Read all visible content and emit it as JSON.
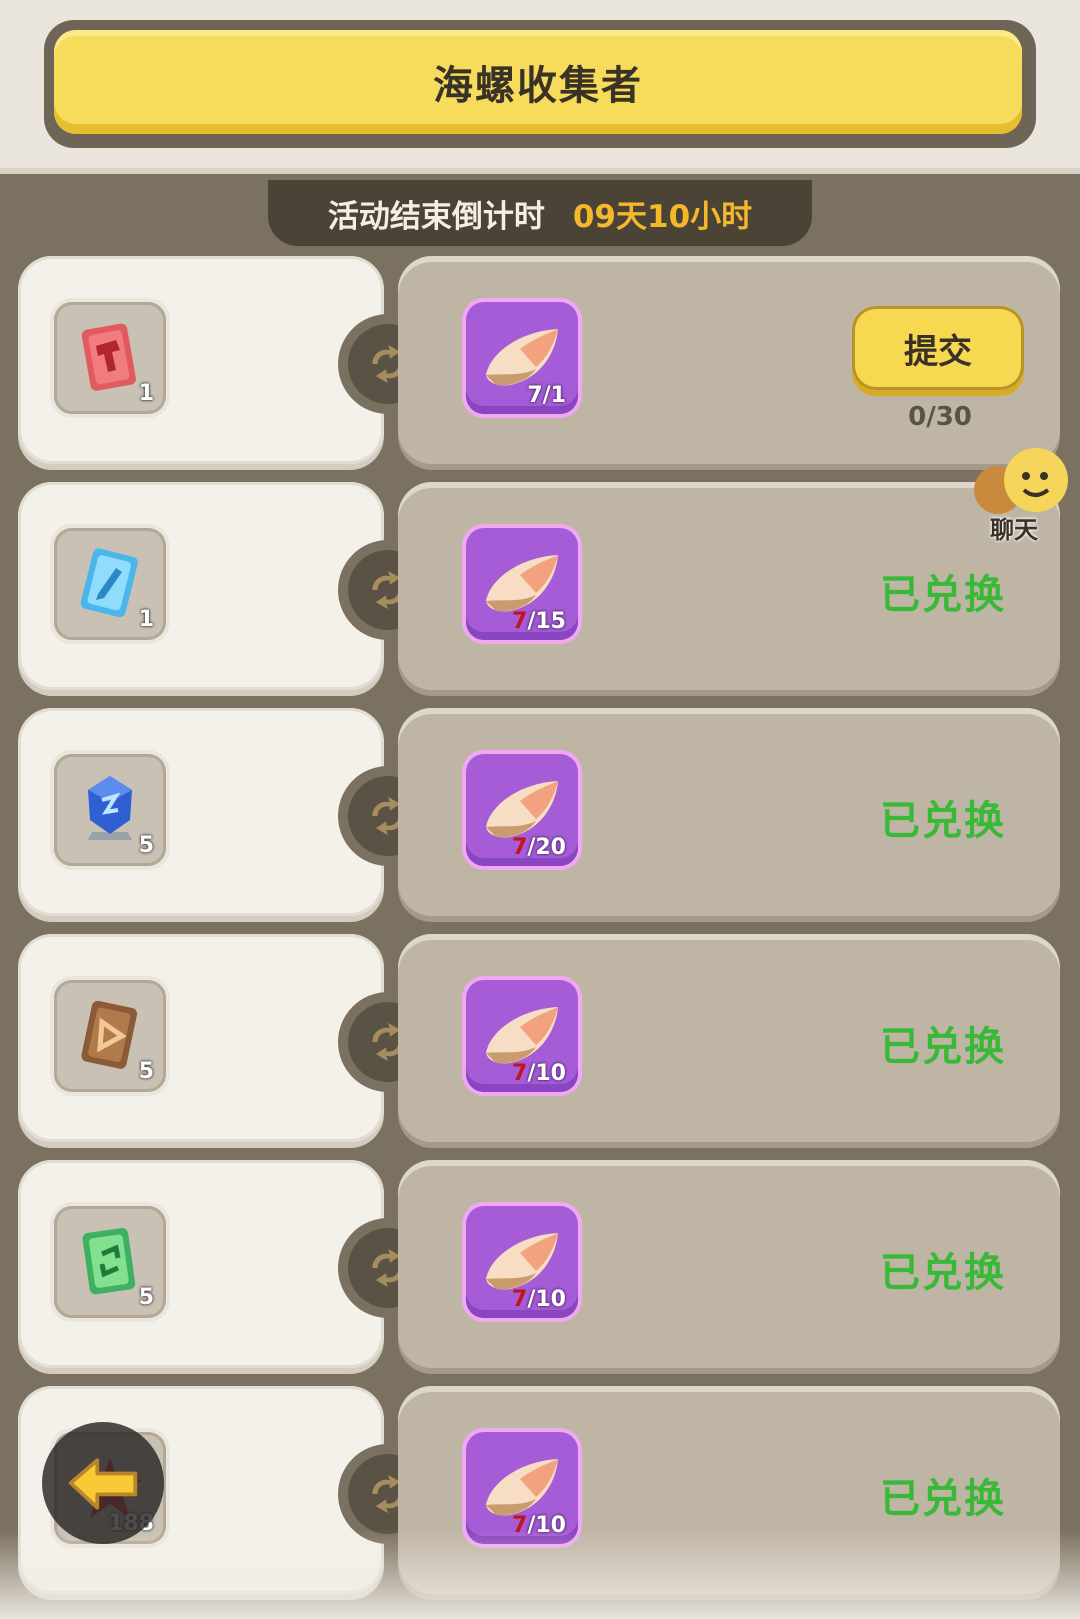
{
  "header": {
    "title": "海螺收集者"
  },
  "countdown": {
    "label": "活动结束倒计时",
    "value": "09天10小时"
  },
  "rows": [
    {
      "item_icon": "red-hammer-card-icon",
      "item_count": "1",
      "shell_have": "7",
      "shell_need": "/1",
      "shell_label": "7/1",
      "action": "提交",
      "progress": "0/30"
    },
    {
      "item_icon": "blue-pen-card-icon",
      "item_count": "1",
      "shell_have": "7",
      "shell_need": "/15",
      "status": "已兑换"
    },
    {
      "item_icon": "blue-crystal-icon",
      "item_count": "5",
      "shell_have": "7",
      "shell_need": "/20",
      "status": "已兑换"
    },
    {
      "item_icon": "brown-play-card-icon",
      "item_count": "5",
      "shell_have": "7",
      "shell_need": "/10",
      "status": "已兑换"
    },
    {
      "item_icon": "green-card-icon",
      "item_count": "5",
      "shell_have": "7",
      "shell_need": "/10",
      "status": "已兑换"
    },
    {
      "item_icon": "red-starfish-icon",
      "item_count": "188",
      "shell_have": "7",
      "shell_need": "/10",
      "status": "已兑换"
    }
  ],
  "chat": {
    "label": "聊天"
  },
  "colors": {
    "accent_yellow": "#f7dc5b",
    "exchanged_green": "#3ab838",
    "shell_purple": "#a55cd6",
    "countdown_orange": "#f5b72c"
  }
}
